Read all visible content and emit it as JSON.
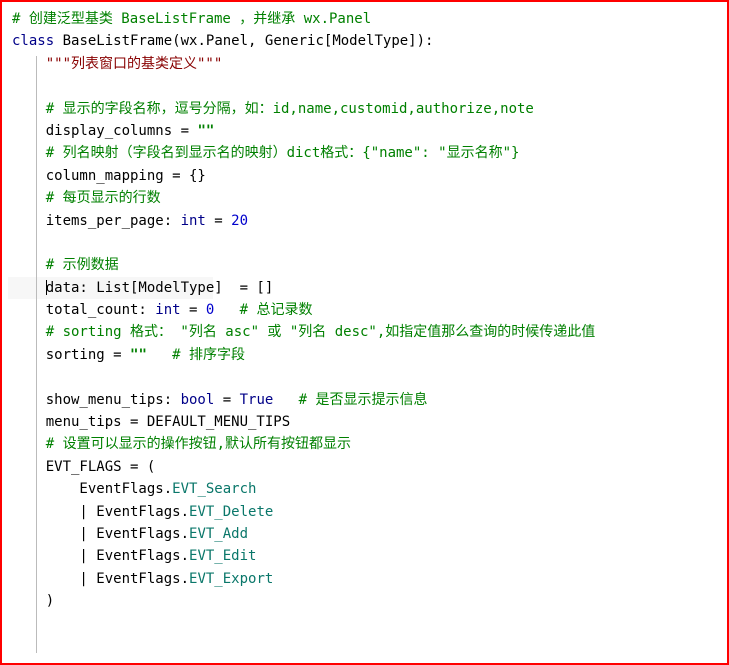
{
  "lines": [
    {
      "c": "c",
      "t": "# 创建泛型基类 BaseListFrame ，并继承 wx.Panel",
      "indent": 0
    },
    {
      "c": "k",
      "html": "<span class='k'>class</span> <span class='fn'>BaseListFrame</span>(wx.Panel, Generic[ModelType]):",
      "indent": 0
    },
    {
      "c": "doc",
      "t": "\"\"\"列表窗口的基类定义\"\"\"",
      "indent": 1
    },
    {
      "blank": true,
      "indent": 1
    },
    {
      "c": "c",
      "t": "# 显示的字段名称，逗号分隔，如：id,name,customid,authorize,note",
      "indent": 1
    },
    {
      "html": "display_columns = <span class='s'>\"\"</span>",
      "indent": 1
    },
    {
      "c": "c",
      "t": "# 列名映射（字段名到显示名的映射）dict格式：{\"name\": \"显示名称\"}",
      "indent": 1
    },
    {
      "html": "column_mapping = {}",
      "indent": 1
    },
    {
      "c": "c",
      "t": "# 每页显示的行数",
      "indent": 1
    },
    {
      "html": "items_per_page: <span class='k'>int</span> = <span class='num'>20</span>",
      "indent": 1
    },
    {
      "blank": true,
      "indent": 1
    },
    {
      "c": "c",
      "t": "# 示例数据",
      "indent": 1
    },
    {
      "html": "<span class='caret'></span>data: List[ModelType]  = []",
      "indent": 1,
      "hl": true
    },
    {
      "html": "total_count: <span class='k'>int</span> = <span class='num'>0</span>   <span class='c'># 总记录数</span>",
      "indent": 1
    },
    {
      "c": "c",
      "t": "# sorting 格式： \"列名 asc\" 或 \"列名 desc\",如指定值那么查询的时候传递此值",
      "indent": 1
    },
    {
      "html": "sorting = <span class='s'>\"\"</span>   <span class='c'># 排序字段</span>",
      "indent": 1
    },
    {
      "blank": true,
      "indent": 1
    },
    {
      "html": "show_menu_tips: <span class='k'>bool</span> = <span class='bool'>True</span>   <span class='c'># 是否显示提示信息</span>",
      "indent": 1
    },
    {
      "html": "menu_tips = DEFAULT_MENU_TIPS",
      "indent": 1
    },
    {
      "c": "c",
      "t": "# 设置可以显示的操作按钮,默认所有按钮都显示",
      "indent": 1
    },
    {
      "html": "EVT_FLAGS = (",
      "indent": 1
    },
    {
      "html": "EventFlags.<span class='member'>EVT_Search</span>",
      "indent": 2
    },
    {
      "html": "| EventFlags.<span class='member'>EVT_Delete</span>",
      "indent": 2
    },
    {
      "html": "| EventFlags.<span class='member'>EVT_Add</span>",
      "indent": 2
    },
    {
      "html": "| EventFlags.<span class='member'>EVT_Edit</span>",
      "indent": 2
    },
    {
      "html": "| EventFlags.<span class='member'>EVT_Export</span>",
      "indent": 2
    },
    {
      "html": ")",
      "indent": 1
    }
  ]
}
